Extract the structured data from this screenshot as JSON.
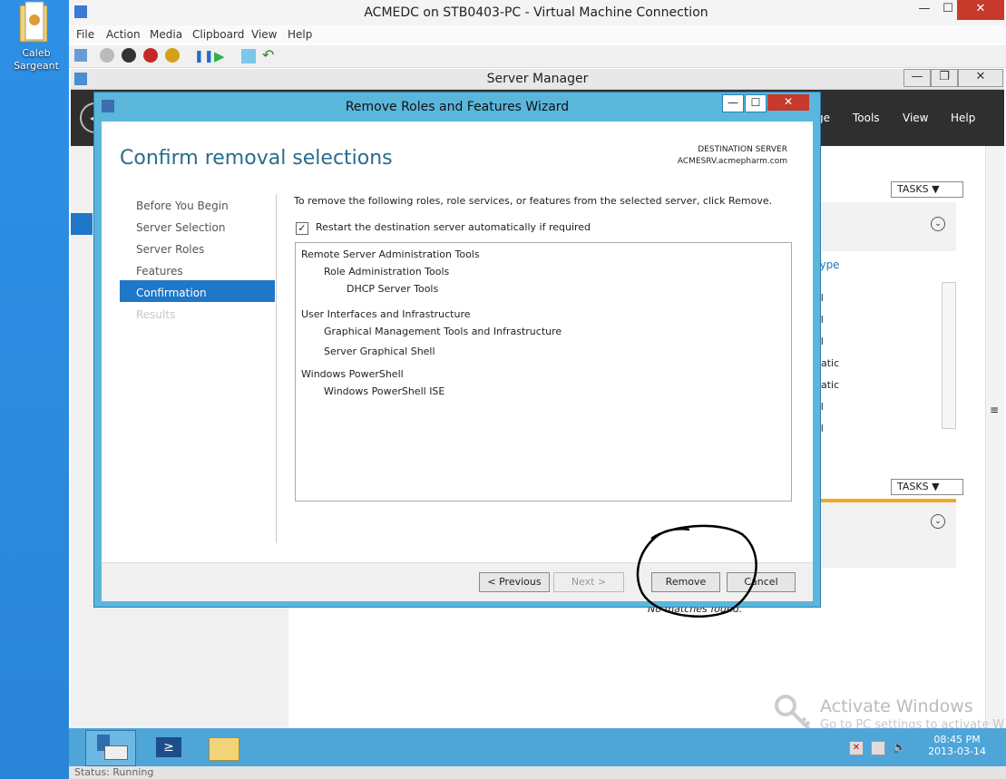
{
  "desktop": {
    "icon_label_line1": "Caleb",
    "icon_label_line2": "Sargeant"
  },
  "vm_window": {
    "title": "ACMEDC on STB0403-PC - Virtual Machine Connection",
    "menu": [
      "File",
      "Action",
      "Media",
      "Clipboard",
      "View",
      "Help"
    ]
  },
  "server_manager": {
    "title": "Server Manager",
    "nav": [
      "ge",
      "Tools",
      "View",
      "Help"
    ],
    "tasks_label": "TASKS",
    "type_header": "Type",
    "partial_rows": [
      "al",
      "al",
      "al",
      "natic",
      "natic",
      "al",
      "al"
    ],
    "no_matches": "No matches found."
  },
  "wizard": {
    "title": "Remove Roles and Features Wizard",
    "heading": "Confirm removal selections",
    "dest_label": "DESTINATION SERVER",
    "dest_server": "ACMESRV.acmepharm.com",
    "steps": [
      "Before You Begin",
      "Server Selection",
      "Server Roles",
      "Features",
      "Confirmation",
      "Results"
    ],
    "active_step": 4,
    "intro": "To remove the following roles, role services, or features from the selected server, click Remove.",
    "restart_label": "Restart the destination server automatically if required",
    "restart_checked": true,
    "items": [
      {
        "text": "Remote Server Administration Tools",
        "level": 0
      },
      {
        "text": "Role Administration Tools",
        "level": 1
      },
      {
        "text": "DHCP Server Tools",
        "level": 2
      },
      {
        "text": "User Interfaces and Infrastructure",
        "level": 0
      },
      {
        "text": "Graphical Management Tools and Infrastructure",
        "level": 1
      },
      {
        "text": "Server Graphical Shell",
        "level": 1
      },
      {
        "text": "Windows PowerShell",
        "level": 0
      },
      {
        "text": "Windows PowerShell ISE",
        "level": 1
      }
    ],
    "buttons": {
      "previous": "< Previous",
      "next": "Next >",
      "remove": "Remove",
      "cancel": "Cancel"
    }
  },
  "watermark": {
    "line1": "Activate Windows",
    "line2": "Go to PC settings to activate W"
  },
  "taskbar": {
    "time": "08:45 PM",
    "date": "2013-03-14"
  },
  "status": {
    "text": "Status: Running"
  },
  "colors": {
    "accent": "#1f77c8",
    "wizard_frame": "#5bb6dc",
    "annotation": "#000000"
  }
}
